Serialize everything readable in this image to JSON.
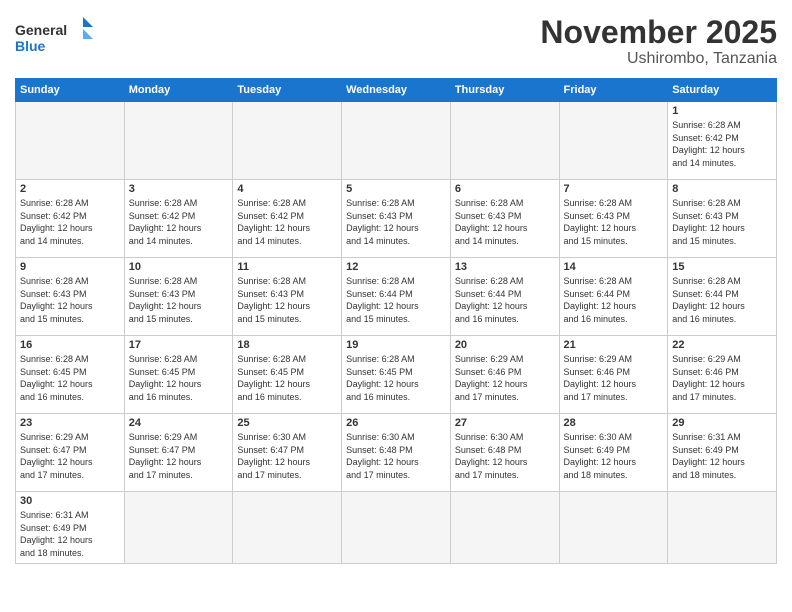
{
  "logo": {
    "general": "General",
    "blue": "Blue"
  },
  "header": {
    "month": "November 2025",
    "location": "Ushirombo, Tanzania"
  },
  "weekdays": [
    "Sunday",
    "Monday",
    "Tuesday",
    "Wednesday",
    "Thursday",
    "Friday",
    "Saturday"
  ],
  "weeks": [
    [
      {
        "day": "",
        "info": ""
      },
      {
        "day": "",
        "info": ""
      },
      {
        "day": "",
        "info": ""
      },
      {
        "day": "",
        "info": ""
      },
      {
        "day": "",
        "info": ""
      },
      {
        "day": "",
        "info": ""
      },
      {
        "day": "1",
        "info": "Sunrise: 6:28 AM\nSunset: 6:42 PM\nDaylight: 12 hours\nand 14 minutes."
      }
    ],
    [
      {
        "day": "2",
        "info": "Sunrise: 6:28 AM\nSunset: 6:42 PM\nDaylight: 12 hours\nand 14 minutes."
      },
      {
        "day": "3",
        "info": "Sunrise: 6:28 AM\nSunset: 6:42 PM\nDaylight: 12 hours\nand 14 minutes."
      },
      {
        "day": "4",
        "info": "Sunrise: 6:28 AM\nSunset: 6:42 PM\nDaylight: 12 hours\nand 14 minutes."
      },
      {
        "day": "5",
        "info": "Sunrise: 6:28 AM\nSunset: 6:43 PM\nDaylight: 12 hours\nand 14 minutes."
      },
      {
        "day": "6",
        "info": "Sunrise: 6:28 AM\nSunset: 6:43 PM\nDaylight: 12 hours\nand 14 minutes."
      },
      {
        "day": "7",
        "info": "Sunrise: 6:28 AM\nSunset: 6:43 PM\nDaylight: 12 hours\nand 15 minutes."
      },
      {
        "day": "8",
        "info": "Sunrise: 6:28 AM\nSunset: 6:43 PM\nDaylight: 12 hours\nand 15 minutes."
      }
    ],
    [
      {
        "day": "9",
        "info": "Sunrise: 6:28 AM\nSunset: 6:43 PM\nDaylight: 12 hours\nand 15 minutes."
      },
      {
        "day": "10",
        "info": "Sunrise: 6:28 AM\nSunset: 6:43 PM\nDaylight: 12 hours\nand 15 minutes."
      },
      {
        "day": "11",
        "info": "Sunrise: 6:28 AM\nSunset: 6:43 PM\nDaylight: 12 hours\nand 15 minutes."
      },
      {
        "day": "12",
        "info": "Sunrise: 6:28 AM\nSunset: 6:44 PM\nDaylight: 12 hours\nand 15 minutes."
      },
      {
        "day": "13",
        "info": "Sunrise: 6:28 AM\nSunset: 6:44 PM\nDaylight: 12 hours\nand 16 minutes."
      },
      {
        "day": "14",
        "info": "Sunrise: 6:28 AM\nSunset: 6:44 PM\nDaylight: 12 hours\nand 16 minutes."
      },
      {
        "day": "15",
        "info": "Sunrise: 6:28 AM\nSunset: 6:44 PM\nDaylight: 12 hours\nand 16 minutes."
      }
    ],
    [
      {
        "day": "16",
        "info": "Sunrise: 6:28 AM\nSunset: 6:45 PM\nDaylight: 12 hours\nand 16 minutes."
      },
      {
        "day": "17",
        "info": "Sunrise: 6:28 AM\nSunset: 6:45 PM\nDaylight: 12 hours\nand 16 minutes."
      },
      {
        "day": "18",
        "info": "Sunrise: 6:28 AM\nSunset: 6:45 PM\nDaylight: 12 hours\nand 16 minutes."
      },
      {
        "day": "19",
        "info": "Sunrise: 6:28 AM\nSunset: 6:45 PM\nDaylight: 12 hours\nand 16 minutes."
      },
      {
        "day": "20",
        "info": "Sunrise: 6:29 AM\nSunset: 6:46 PM\nDaylight: 12 hours\nand 17 minutes."
      },
      {
        "day": "21",
        "info": "Sunrise: 6:29 AM\nSunset: 6:46 PM\nDaylight: 12 hours\nand 17 minutes."
      },
      {
        "day": "22",
        "info": "Sunrise: 6:29 AM\nSunset: 6:46 PM\nDaylight: 12 hours\nand 17 minutes."
      }
    ],
    [
      {
        "day": "23",
        "info": "Sunrise: 6:29 AM\nSunset: 6:47 PM\nDaylight: 12 hours\nand 17 minutes."
      },
      {
        "day": "24",
        "info": "Sunrise: 6:29 AM\nSunset: 6:47 PM\nDaylight: 12 hours\nand 17 minutes."
      },
      {
        "day": "25",
        "info": "Sunrise: 6:30 AM\nSunset: 6:47 PM\nDaylight: 12 hours\nand 17 minutes."
      },
      {
        "day": "26",
        "info": "Sunrise: 6:30 AM\nSunset: 6:48 PM\nDaylight: 12 hours\nand 17 minutes."
      },
      {
        "day": "27",
        "info": "Sunrise: 6:30 AM\nSunset: 6:48 PM\nDaylight: 12 hours\nand 17 minutes."
      },
      {
        "day": "28",
        "info": "Sunrise: 6:30 AM\nSunset: 6:49 PM\nDaylight: 12 hours\nand 18 minutes."
      },
      {
        "day": "29",
        "info": "Sunrise: 6:31 AM\nSunset: 6:49 PM\nDaylight: 12 hours\nand 18 minutes."
      }
    ],
    [
      {
        "day": "30",
        "info": "Sunrise: 6:31 AM\nSunset: 6:49 PM\nDaylight: 12 hours\nand 18 minutes."
      },
      {
        "day": "",
        "info": ""
      },
      {
        "day": "",
        "info": ""
      },
      {
        "day": "",
        "info": ""
      },
      {
        "day": "",
        "info": ""
      },
      {
        "day": "",
        "info": ""
      },
      {
        "day": "",
        "info": ""
      }
    ]
  ]
}
